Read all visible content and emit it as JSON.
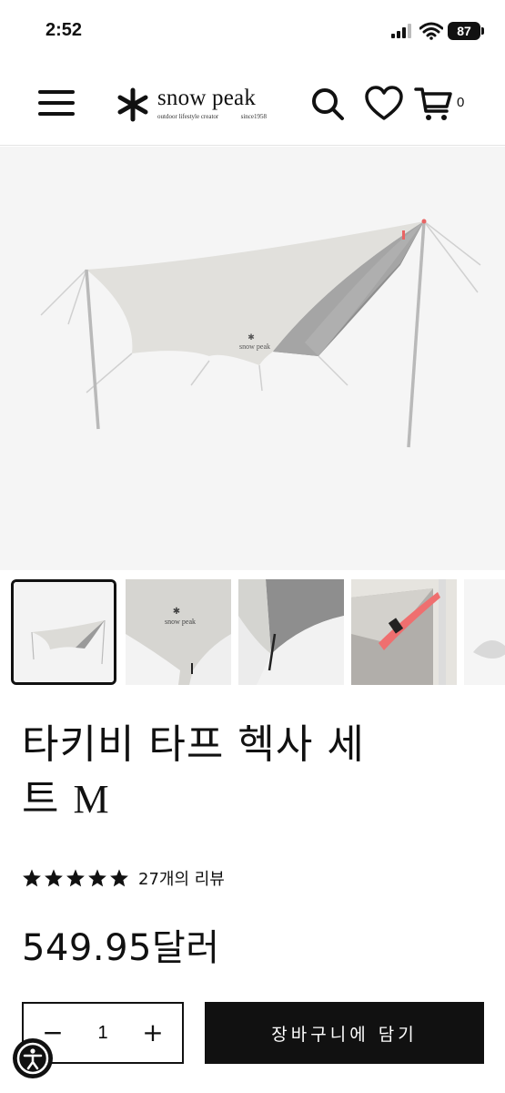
{
  "status_bar": {
    "time": "2:52",
    "battery": "87"
  },
  "header": {
    "brand": {
      "name": "snow peak",
      "tagline": "outdoor lifestyle creator",
      "since": "since1958"
    },
    "icons": [
      "menu-icon",
      "search-icon",
      "heart-icon",
      "cart-icon"
    ],
    "cart_count": "0"
  },
  "hero": {
    "tarp_logo_text": "snow peak"
  },
  "thumbnails": [
    {
      "label": "thumbnail-1",
      "selected": true
    },
    {
      "label": "thumbnail-2",
      "selected": false,
      "logo_text": "snow peak"
    },
    {
      "label": "thumbnail-3",
      "selected": false
    },
    {
      "label": "thumbnail-4",
      "selected": false
    },
    {
      "label": "thumbnail-5",
      "selected": false
    }
  ],
  "product": {
    "title_line1": "타키비 타프 헥사 세",
    "title_line2_prefix": "트 ",
    "title_line2_suffix": "M",
    "rating": 5,
    "review_count": "27개의 리뷰",
    "price": "549.95달러"
  },
  "purchase": {
    "minus_label": "−",
    "quantity": "1",
    "plus_label": "+",
    "add_to_cart_label": "장바구니에 담기"
  },
  "colors": {
    "primary": "#111111",
    "hero_bg": "#f5f5f5",
    "accent": "#e86464"
  }
}
